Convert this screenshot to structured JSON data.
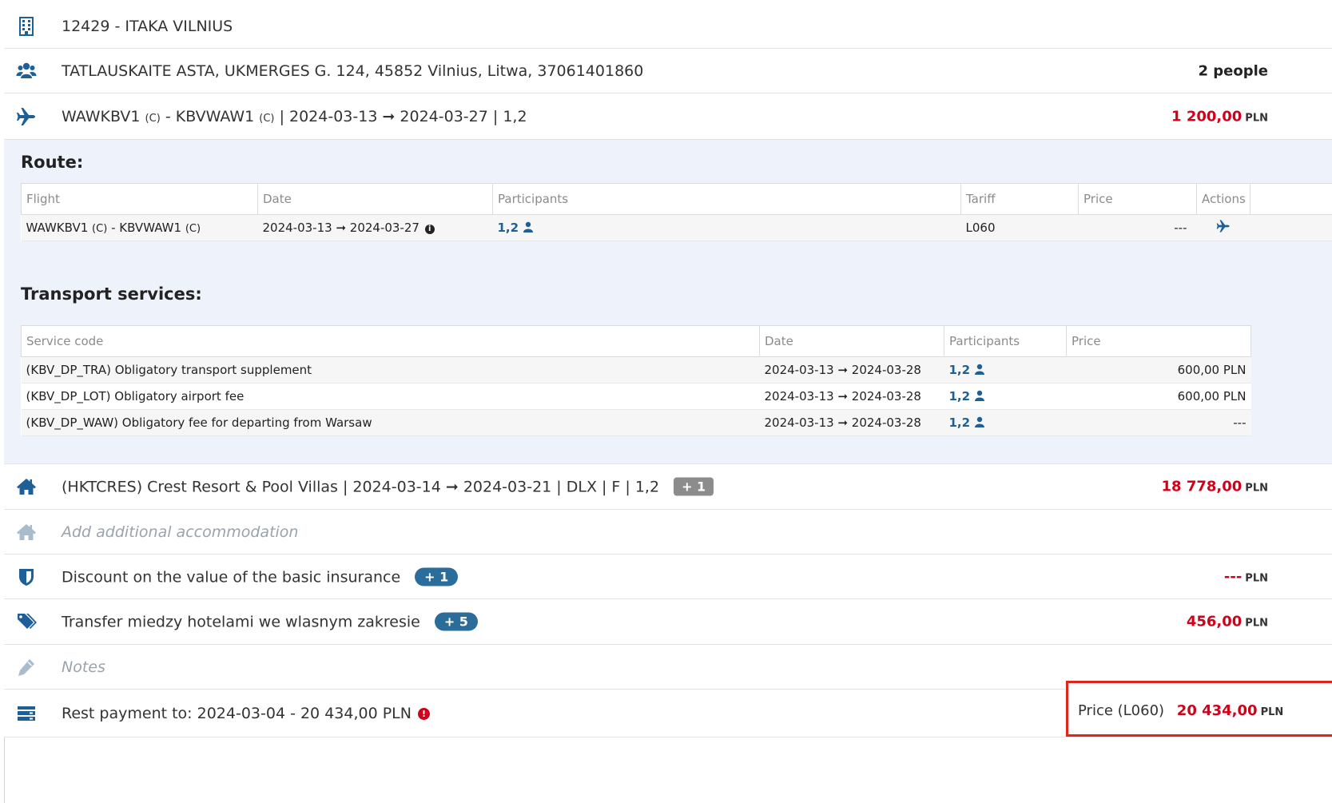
{
  "agency": {
    "text": "12429 - ITAKA VILNIUS",
    "icon": "building-icon"
  },
  "client": {
    "text": "TATLAUSKAITE ASTA, UKMERGES G. 124, 45852 Vilnius, Litwa, 37061401860",
    "people": "2 people",
    "icon": "users-icon"
  },
  "flight": {
    "from": "WAWKBV1",
    "to": "KBVWAW1",
    "class_tag": "(C)",
    "sep": "-",
    "dates": "| 2024-03-13 ➞ 2024-03-27 | 1,2",
    "price": "1 200,00",
    "currency": "PLN",
    "icon": "plane-icon"
  },
  "route": {
    "heading": "Route:",
    "columns": [
      "Flight",
      "Date",
      "Participants",
      "Tariff",
      "Price",
      "Actions"
    ],
    "rows": [
      {
        "flight": "WAWKBV1",
        "flight_to": "KBVWAW1",
        "class_tag": "(C)",
        "date": "2024-03-13 ➞ 2024-03-27",
        "participants": "1,2",
        "tariff": "L060",
        "price": "---"
      }
    ]
  },
  "transport": {
    "heading": "Transport services:",
    "columns": [
      "Service code",
      "Date",
      "Participants",
      "Price"
    ],
    "rows": [
      {
        "code": "(KBV_DP_TRA) Obligatory transport supplement",
        "date": "2024-03-13 ➞ 2024-03-28",
        "participants": "1,2",
        "price": "600,00 PLN"
      },
      {
        "code": "(KBV_DP_LOT) Obligatory airport fee",
        "date": "2024-03-13 ➞ 2024-03-28",
        "participants": "1,2",
        "price": "600,00 PLN"
      },
      {
        "code": "(KBV_DP_WAW) Obligatory fee for departing from Warsaw",
        "date": "2024-03-13 ➞ 2024-03-28",
        "participants": "1,2",
        "price": "---"
      }
    ]
  },
  "hotel": {
    "text": "(HKTCRES) Crest Resort & Pool Villas | 2024-03-14 ➞ 2024-03-21 | DLX | F | 1,2",
    "badge": "+ 1",
    "price": "18 778,00",
    "currency": "PLN",
    "icon": "home-icon"
  },
  "add_accommodation": {
    "text": "Add additional accommodation",
    "icon": "home-icon"
  },
  "insurance": {
    "text": "Discount on the value of the basic insurance",
    "badge": "+ 1",
    "price": "---",
    "currency": "PLN",
    "icon": "shield-icon"
  },
  "transfer": {
    "text": "Transfer miedzy hotelami we wlasnym zakresie",
    "badge": "+ 5",
    "price": "456,00",
    "currency": "PLN",
    "icon": "tags-icon"
  },
  "notes": {
    "text": "Notes",
    "icon": "pencil-icon"
  },
  "payment": {
    "text": "Rest payment to: 2024-03-04 - 20 434,00 PLN",
    "info": "!",
    "price_label": "Price (L060)",
    "price": "20 434,00",
    "currency": "PLN",
    "icon": "payment-icon"
  },
  "colors": {
    "accent": "#1f5f97",
    "price_red": "#d0021b",
    "panel_bg": "#eef2fb",
    "badge_blue": "#2a6c9a",
    "highlight_border": "#e0261b"
  }
}
